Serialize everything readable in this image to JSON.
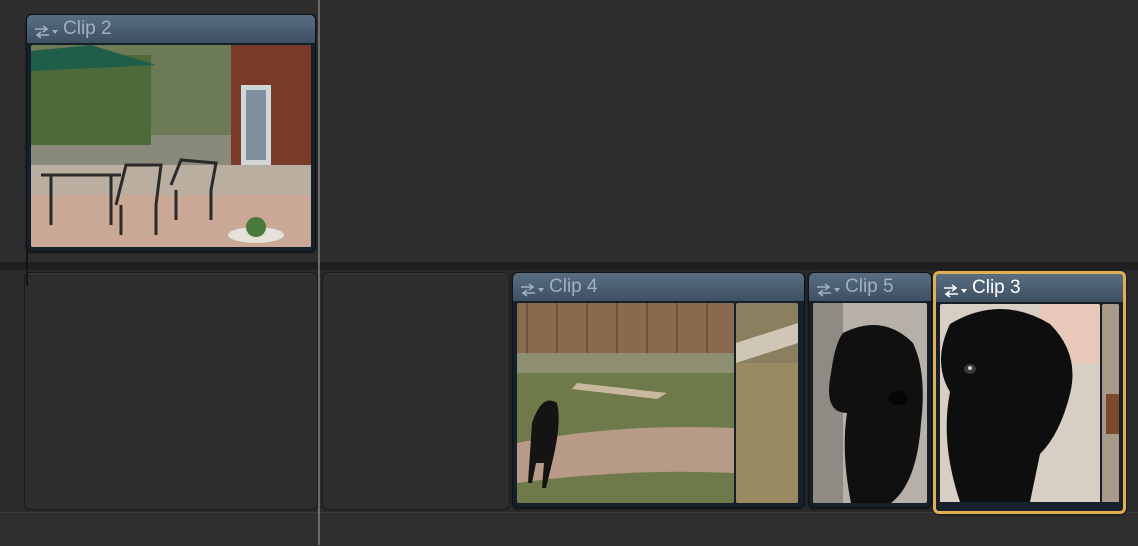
{
  "timeline": {
    "clips": [
      {
        "name": "Clip 2",
        "selected": false,
        "icon": "retime-menu-icon",
        "thumbnail": "backyard-patio-with-umbrella-and-chairs"
      },
      {
        "name": "Clip 4",
        "selected": false,
        "icon": "retime-menu-icon",
        "thumbnail": "black-dog-walking-on-garden-path"
      },
      {
        "name": "Clip 5",
        "selected": false,
        "icon": "retime-menu-icon",
        "thumbnail": "black-dog-close-up"
      },
      {
        "name": "Clip 3",
        "selected": true,
        "icon": "retime-menu-icon",
        "thumbnail": "black-dog-face-close-up"
      }
    ],
    "colors": {
      "background": "#2c2c2c",
      "clip_header": "#4a5d70",
      "clip_label": "#9fb0c2",
      "selected_label": "#ffffff",
      "selection_outline": "#e2b053",
      "playhead": "#6b6b6b"
    }
  }
}
